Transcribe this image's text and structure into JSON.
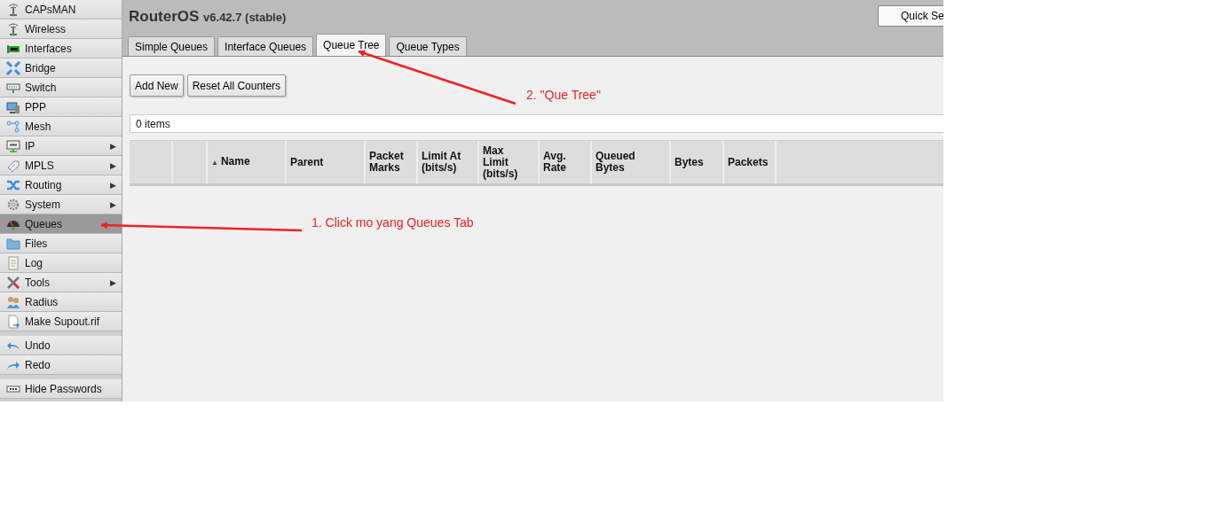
{
  "sidebar": {
    "groups": [
      {
        "items": [
          {
            "label": "CAPsMAN",
            "selected": false
          },
          {
            "label": "Wireless",
            "selected": false
          },
          {
            "label": "Interfaces",
            "selected": false
          },
          {
            "label": "Bridge",
            "selected": false
          },
          {
            "label": "Switch",
            "selected": false
          },
          {
            "label": "PPP",
            "selected": false
          },
          {
            "label": "Mesh",
            "selected": false
          },
          {
            "label": "IP",
            "submenu": "▶",
            "selected": false
          },
          {
            "label": "MPLS",
            "submenu": "▶",
            "selected": false
          },
          {
            "label": "Routing",
            "submenu": "▶",
            "selected": false
          },
          {
            "label": "System",
            "submenu": "▶",
            "selected": false
          },
          {
            "label": "Queues",
            "selected": true
          },
          {
            "label": "Files",
            "selected": false
          },
          {
            "label": "Log",
            "selected": false
          },
          {
            "label": "Tools",
            "submenu": "▶",
            "selected": false
          },
          {
            "label": "Radius",
            "selected": false
          },
          {
            "label": "Make Supout.rif",
            "selected": false
          }
        ]
      },
      {
        "items": [
          {
            "label": "Undo",
            "selected": false
          },
          {
            "label": "Redo",
            "selected": false
          }
        ]
      },
      {
        "items": [
          {
            "label": "Hide Passwords",
            "selected": false
          }
        ]
      }
    ]
  },
  "header": {
    "title": "RouterOS",
    "version": "v6.42.7 (stable)",
    "quick_set": "Quick Se"
  },
  "tabs": [
    {
      "label": "Simple Queues",
      "selected": false
    },
    {
      "label": "Interface Queues",
      "selected": false
    },
    {
      "label": "Queue Tree",
      "selected": true
    },
    {
      "label": "Queue Types",
      "selected": false
    }
  ],
  "toolbar": {
    "buttons": [
      "Add New",
      "Reset All Counters"
    ]
  },
  "item_count": "0 items",
  "table": {
    "columns": [
      {
        "label": "Name",
        "sort": "▲"
      },
      {
        "label": "Parent"
      },
      {
        "label": "Packet Marks"
      },
      {
        "label": "Limit At (bits/s)"
      },
      {
        "label": "Max Limit (bits/s)"
      },
      {
        "label": "Avg. Rate"
      },
      {
        "label": "Queued Bytes"
      },
      {
        "label": "Bytes"
      },
      {
        "label": "Packets"
      }
    ]
  },
  "annotations": [
    {
      "text": "1. Click mo yang Queues Tab"
    },
    {
      "text": "2. \"Que Tree\""
    }
  ]
}
